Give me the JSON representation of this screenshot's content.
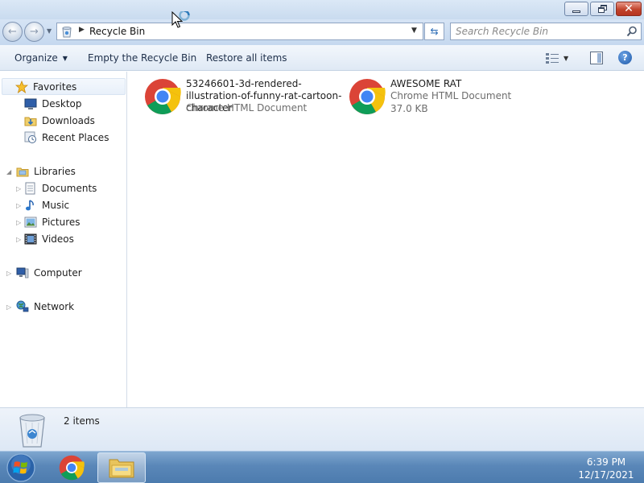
{
  "window": {
    "address": "Recycle Bin",
    "search_placeholder": "Search Recycle Bin"
  },
  "toolbar": {
    "organize_label": "Organize",
    "empty_label": "Empty the Recycle Bin",
    "restore_label": "Restore all items"
  },
  "navpane": {
    "favorites": "Favorites",
    "desktop": "Desktop",
    "downloads": "Downloads",
    "recent_places": "Recent Places",
    "libraries": "Libraries",
    "documents": "Documents",
    "music": "Music",
    "pictures": "Pictures",
    "videos": "Videos",
    "computer": "Computer",
    "network": "Network"
  },
  "files": [
    {
      "name": "53246601-3d-rendered-illustration-of-funny-rat-cartoon-character",
      "type": "Chrome HTML Document",
      "size": ""
    },
    {
      "name": "AWESOME RAT",
      "type": "Chrome HTML Document",
      "size": "37.0 KB"
    }
  ],
  "details": {
    "item_count": "2 items"
  },
  "taskbar": {
    "time": "6:39 PM",
    "date": "12/17/2021"
  },
  "colors": {
    "close_button": "#c1432c",
    "taskbar": "#5a87b8",
    "accent": "#2a6bb5"
  }
}
